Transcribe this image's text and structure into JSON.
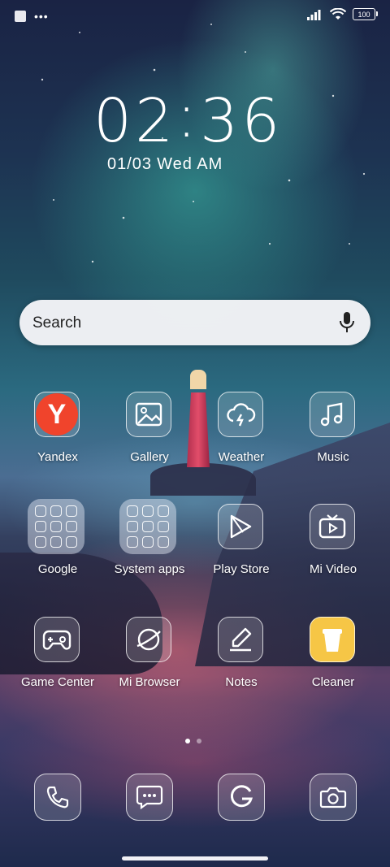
{
  "status_bar": {
    "left_icons": [
      "notification-square-icon",
      "more-dots-icon"
    ],
    "more_dots": "•••",
    "right_icons": [
      "signal-icon",
      "wifi-icon",
      "battery-icon"
    ],
    "battery_level": "100"
  },
  "lock": {
    "time_hours": "02",
    "time_colon": ":",
    "time_minutes": "36",
    "date": "01/03",
    "weekday_ampm": "Wed AM"
  },
  "search": {
    "placeholder": "Search"
  },
  "apps": [
    {
      "label": "Yandex",
      "icon": "yandex-icon"
    },
    {
      "label": "Gallery",
      "icon": "gallery-icon"
    },
    {
      "label": "Weather",
      "icon": "weather-icon"
    },
    {
      "label": "Music",
      "icon": "music-icon"
    },
    {
      "label": "Google",
      "icon": "folder-icon"
    },
    {
      "label": "System apps",
      "icon": "folder-icon"
    },
    {
      "label": "Play Store",
      "icon": "play-store-icon"
    },
    {
      "label": "Mi Video",
      "icon": "mi-video-icon"
    },
    {
      "label": "Game Center",
      "icon": "game-center-icon"
    },
    {
      "label": "Mi Browser",
      "icon": "mi-browser-icon"
    },
    {
      "label": "Notes",
      "icon": "notes-icon"
    },
    {
      "label": "Cleaner",
      "icon": "cleaner-icon"
    }
  ],
  "dock": [
    {
      "icon": "phone-icon"
    },
    {
      "icon": "messages-icon"
    },
    {
      "icon": "google-icon"
    },
    {
      "icon": "camera-icon"
    }
  ],
  "pages": {
    "count": 2,
    "active": 1
  },
  "colors": {
    "yandex_red": "#f0442c",
    "cleaner_yellow": "#f6c646"
  }
}
